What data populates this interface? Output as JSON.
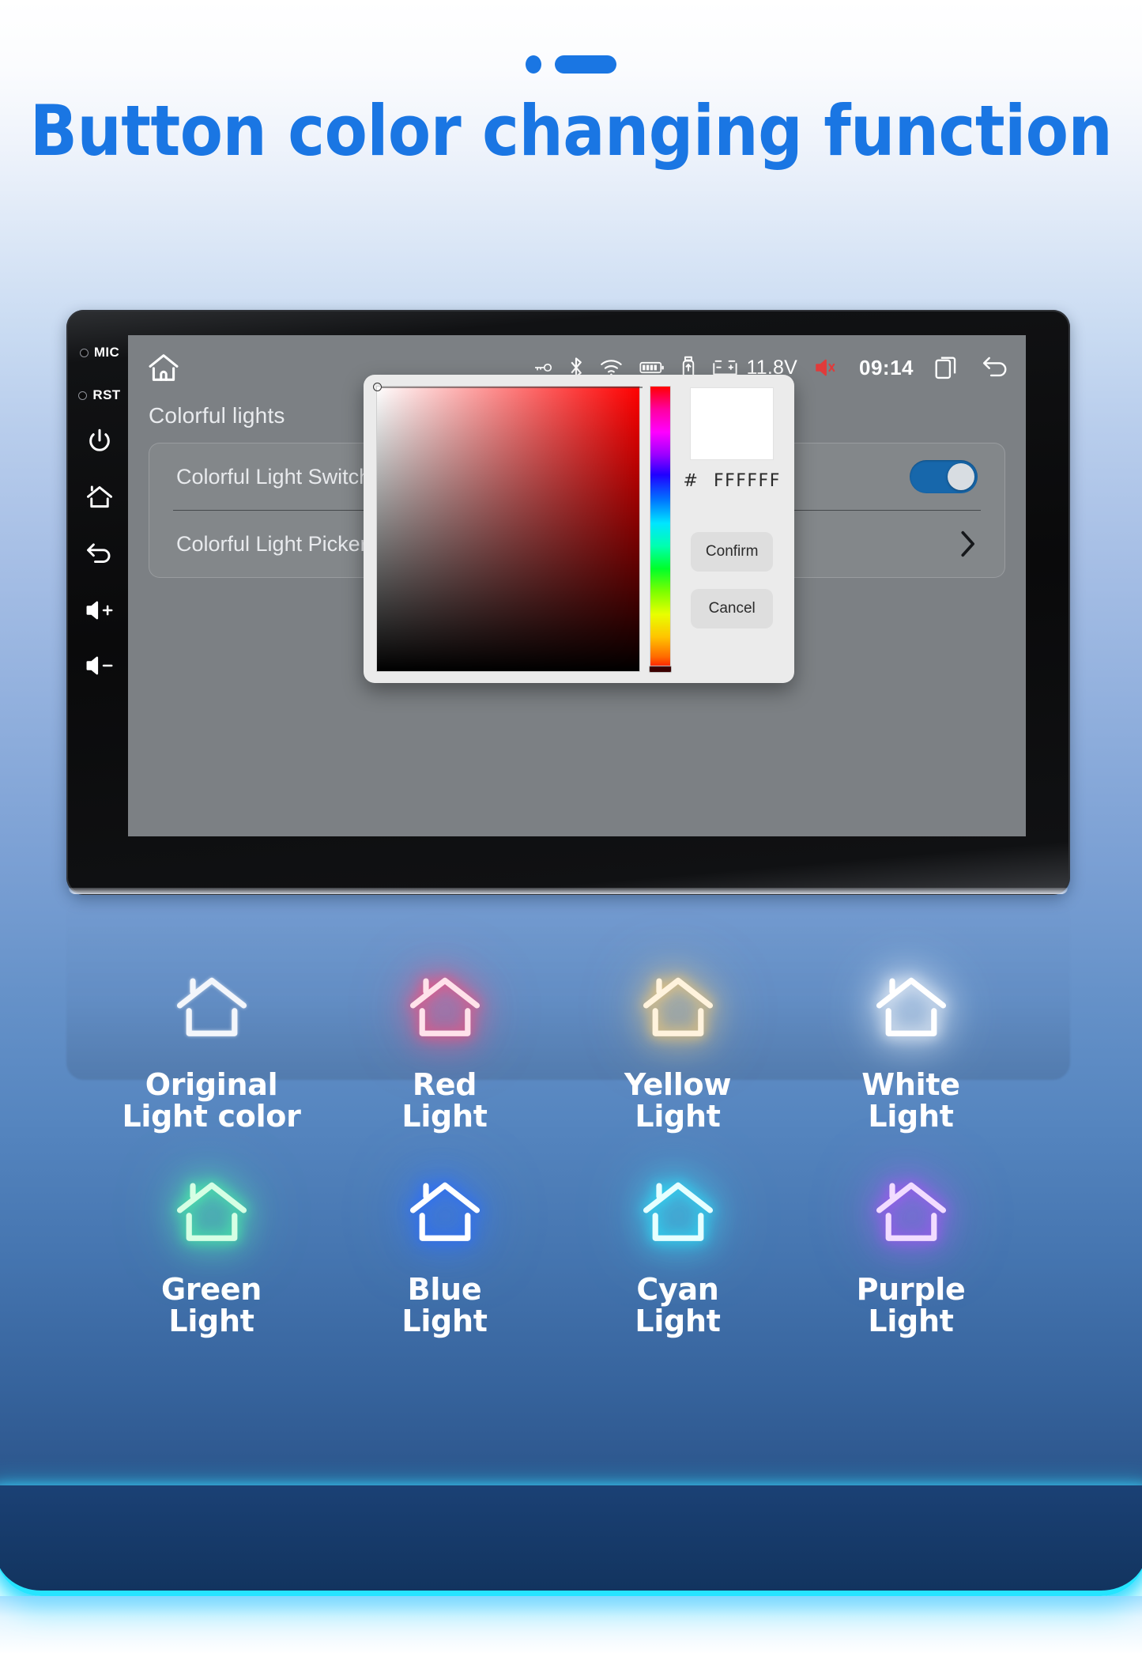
{
  "header": {
    "title": "Button color changing function",
    "deco_dot": "dot-marker",
    "deco_bar": "bar-marker"
  },
  "device": {
    "bezel": {
      "items": [
        {
          "name": "mic",
          "label": "MIC",
          "type": "hole-label"
        },
        {
          "name": "reset",
          "label": "RST",
          "type": "hole-label"
        },
        {
          "name": "power",
          "label": "power-icon",
          "type": "icon"
        },
        {
          "name": "home",
          "label": "home-icon",
          "type": "icon"
        },
        {
          "name": "back",
          "label": "back-icon",
          "type": "icon"
        },
        {
          "name": "volume-up",
          "label": "volume-up-icon",
          "type": "icon"
        },
        {
          "name": "volume-down",
          "label": "volume-down-icon",
          "type": "icon"
        }
      ]
    },
    "statusbar": {
      "home_icon": "home-icon",
      "icons": [
        "key-icon",
        "bluetooth-icon",
        "wifi-icon",
        "battery-icon",
        "usb-icon",
        "car-battery-icon"
      ],
      "voltage": "11.8V",
      "mute_icon": "mute-speaker-icon",
      "mute_color": "#e03b3b",
      "time": "09:14",
      "recents_icon": "recent-apps-icon",
      "back_icon": "back-arrow-icon"
    },
    "screen": {
      "page_title": "Colorful lights",
      "rows": [
        {
          "label": "Colorful Light Switch",
          "control": "toggle",
          "toggle_on": true
        },
        {
          "label": "Colorful Light Picker",
          "control": "chevron"
        }
      ],
      "toggle_color": "#1767ab"
    },
    "dialog": {
      "hex_prefix": "#",
      "hex_value": "FFFFFF",
      "preview_color": "#FFFFFF",
      "confirm_label": "Confirm",
      "cancel_label": "Cancel",
      "sv_hue": "#ff0000",
      "hue_thumb_position": "bottom"
    }
  },
  "lights": {
    "items": [
      {
        "label": "Original\nLight color",
        "glow": "#ffffff",
        "stroke": "#f3f6fb",
        "intensity": "none"
      },
      {
        "label": "Red\nLight",
        "glow": "#ff4d7a",
        "stroke": "#ffe2ea",
        "intensity": "strong"
      },
      {
        "label": "Yellow\nLight",
        "glow": "#ffcf70",
        "stroke": "#fff3dd",
        "intensity": "strong"
      },
      {
        "label": "White\nLight",
        "glow": "#ffffff",
        "stroke": "#ffffff",
        "intensity": "strong"
      },
      {
        "label": "Green\nLight",
        "glow": "#49ffa6",
        "stroke": "#d6ffe4",
        "intensity": "strong"
      },
      {
        "label": "Blue\nLight",
        "glow": "#2a6dff",
        "stroke": "#ffffff",
        "intensity": "strong"
      },
      {
        "label": "Cyan\nLight",
        "glow": "#2ae8ff",
        "stroke": "#e6ffff",
        "intensity": "strong"
      },
      {
        "label": "Purple\nLight",
        "glow": "#a855f7",
        "stroke": "#f2dcff",
        "intensity": "strong"
      }
    ]
  },
  "footer": {
    "accent_color": "#26e4ff"
  }
}
